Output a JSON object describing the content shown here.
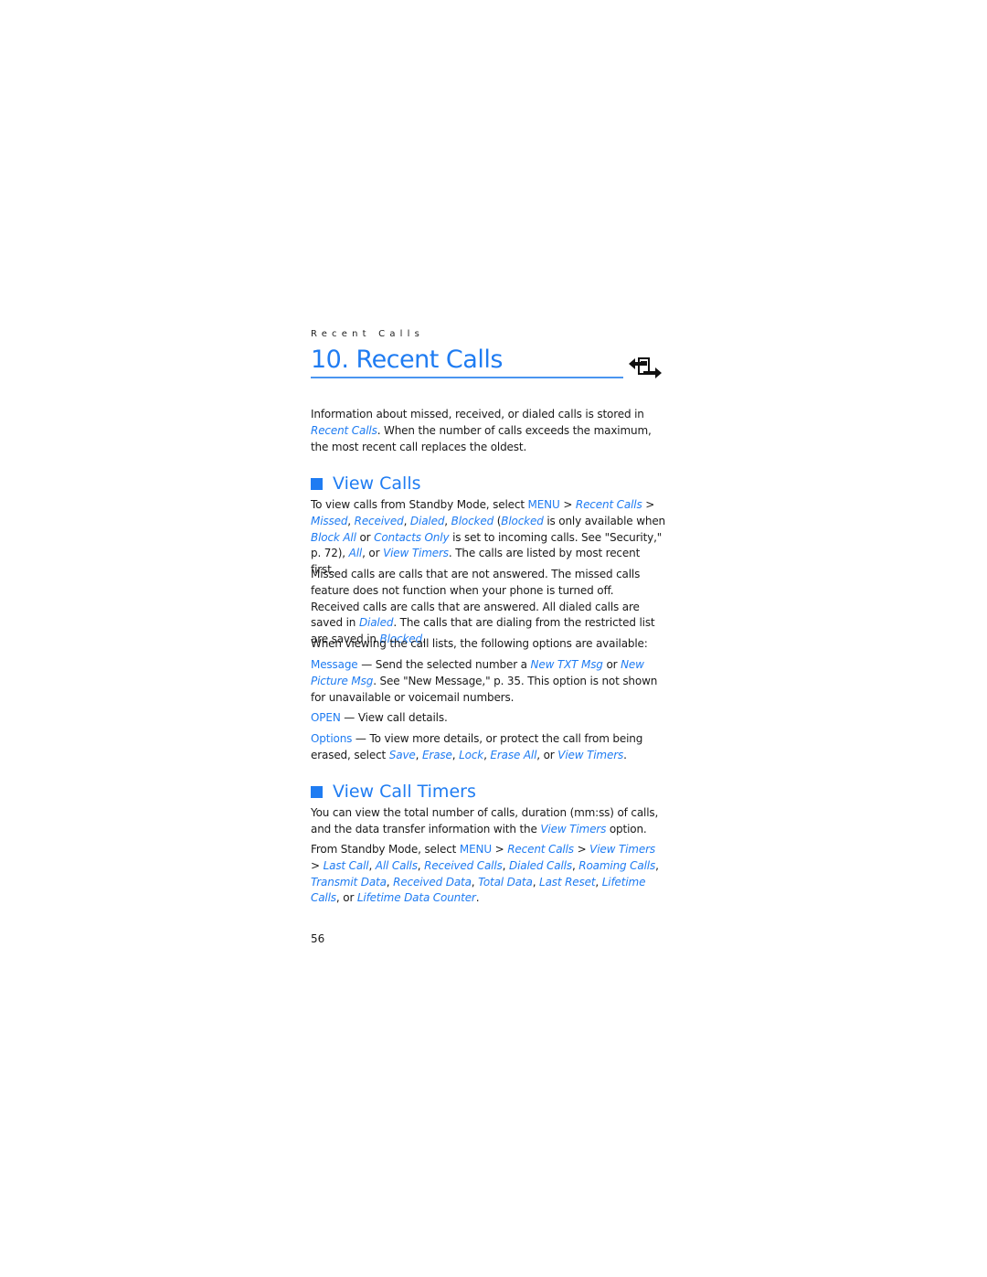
{
  "running_head": "Recent Calls",
  "chapter": {
    "title": "10. Recent Calls",
    "icon": "recent-calls-arrows-icon"
  },
  "intro": {
    "t1": "Information about missed, received, or dialed calls is stored in ",
    "l1": "Recent Calls",
    "t2": ". When the number of calls exceeds the maximum, the most recent call replaces the oldest."
  },
  "view_calls": {
    "heading": "View Calls",
    "p1": {
      "t1": "To view calls from Standby Mode, select ",
      "menu": "MENU",
      "t2": " > ",
      "l_recent": "Recent Calls",
      "t3": " > ",
      "l_missed": "Missed",
      "c1": ", ",
      "l_received": "Received",
      "c2": ", ",
      "l_dialed": "Dialed",
      "c3": ", ",
      "l_blocked": "Blocked",
      "t4": " (",
      "l_blocked2": "Blocked",
      "t5": " is only available when ",
      "l_blockall": "Block All",
      "t6": " or ",
      "l_contacts": "Contacts Only",
      "t7": " is set to incoming calls. See \"Security,\" p. 72), ",
      "l_all": "All",
      "t8": ", or ",
      "l_timers": "View Timers",
      "t9": ". The calls are listed by most recent first."
    },
    "p2": {
      "t1": "Missed calls are calls that are not answered. The missed calls feature does not function when your phone is turned off. Received calls are calls that are answered. All dialed calls are saved in ",
      "l_dialed": "Dialed",
      "t2": ". The calls that are dialing from the restricted list are saved in ",
      "l_blocked": "Blocked",
      "t3": "."
    },
    "p3": "When viewing the call lists, the following options are available:",
    "opt_message": {
      "label": "Message",
      "t1": " — Send the selected number a ",
      "l1": "New TXT Msg",
      "t2": " or ",
      "l2": "New Picture Msg",
      "t3": ". See \"New Message,\" p. 35. This option is not shown for unavailable or voicemail numbers."
    },
    "opt_open": {
      "label": "OPEN",
      "t1": " — View call details."
    },
    "opt_options": {
      "label": "Options",
      "t1": " — To view more details, or protect the call from being erased, select ",
      "l_save": "Save",
      "c1": ", ",
      "l_erase": "Erase",
      "c2": ", ",
      "l_lock": "Lock",
      "c3": ", ",
      "l_eraseall": "Erase All",
      "t2": ", or ",
      "l_timers": "View Timers",
      "t3": "."
    }
  },
  "view_call_timers": {
    "heading": "View Call Timers",
    "p1": {
      "t1": "You can view the total number of calls, duration (mm:ss) of calls, and the data transfer information with the ",
      "l1": "View Timers",
      "t2": " option."
    },
    "p2": {
      "t1": "From Standby Mode, select ",
      "menu": "MENU",
      "s1": " > ",
      "l_recent": "Recent Calls",
      "s2": " > ",
      "l_timers": "View Timers",
      "s3": " > ",
      "items": [
        "Last Call",
        "All Calls",
        "Received Calls",
        "Dialed Calls",
        "Roaming Calls",
        "Transmit Data",
        "Received Data",
        "Total Data",
        "Last Reset",
        "Lifetime Calls"
      ],
      "or": "or ",
      "l_last": "Lifetime Data Counter",
      "end": "."
    }
  },
  "page_number": "56",
  "colors": {
    "accent": "#1f7cf2",
    "text": "#1a1a1a"
  }
}
